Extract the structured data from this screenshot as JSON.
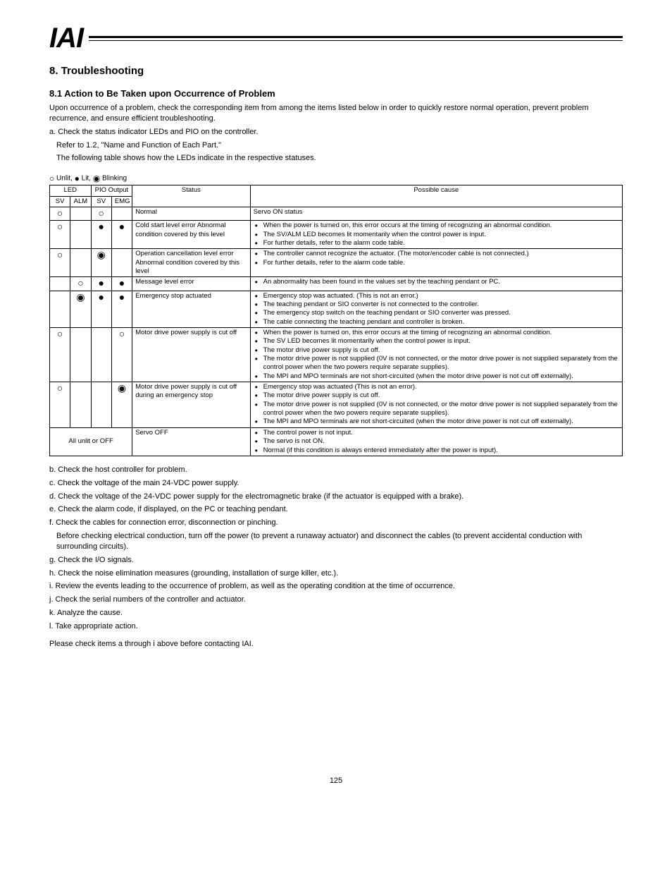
{
  "logo_text": "IAI",
  "section": {
    "number": "8.",
    "title": "Troubleshooting",
    "sub_number": "8.1",
    "sub_title": "Action to Be Taken upon Occurrence of Problem"
  },
  "intro1": "Upon occurrence of a problem, check the corresponding item from among the items listed below in order to quickly restore normal operation, prevent problem recurrence, and ensure efficient troubleshooting.",
  "check_a": {
    "label": "a. Check the status indicator LEDs and PIO on the controller.",
    "ref": "Refer to 1.2, \"Name and Function of Each Part.\""
  },
  "led_table_intro": "The following table shows how the LEDs indicate in the respective statuses.",
  "legend": {
    "unlit": "Unlit,",
    "lit": "Lit,",
    "blink": "Blinking"
  },
  "headers": {
    "led": "LED",
    "pio": "PIO Output",
    "alm": "ALM",
    "sv": "SV",
    "emg": "EMG",
    "status": "Status",
    "cause": "Possible cause"
  },
  "rows": {
    "r1": {
      "status": "Normal",
      "cause_note": "Servo ON status"
    },
    "r2": {
      "status": "Cold start level error Abnormal condition covered by this level",
      "c1": "When the power is turned on, this error occurs at the timing of recognizing an abnormal condition.",
      "c2": "The SV/ALM LED becomes lit momentarily when the control power is input.",
      "c3": "For further details, refer to the alarm code table."
    },
    "r3": {
      "status": "Operation cancellation level error Abnormal condition covered by this level",
      "c1": "The controller cannot recognize the actuator. (The motor/encoder cable is not connected.)",
      "c2": "For further details, refer to the alarm code table."
    },
    "r4": {
      "status": "Message level error",
      "c1": "An abnormality has been found in the values set by the teaching pendant or PC."
    },
    "r5": {
      "status": "Emergency stop actuated",
      "c1": "Emergency stop was actuated. (This is not an error.)",
      "c2": "The teaching pendant or SIO converter is not connected to the controller.",
      "c3": "The emergency stop switch on the teaching pendant or SIO converter was pressed.",
      "c4": "The cable connecting the teaching pendant and controller is broken."
    },
    "r6": {
      "status": "Motor drive power supply is cut off",
      "c1": "When the power is turned on, this error occurs at the timing of recognizing an abnormal condition.",
      "c2": "The SV LED becomes lit momentarily when the control power is input.",
      "c3": "The motor drive power supply is cut off.",
      "c4": "The motor drive power is not supplied (0V is not connected, or the motor drive power is not supplied separately from the control power when the two powers require separate supplies).",
      "c5": "The MPI and MPO terminals are not short-circuited (when the motor drive power is not cut off externally)."
    },
    "r7": {
      "status": "Motor drive power supply is cut off during an emergency stop",
      "c1": "Emergency stop was actuated (This is not an error).",
      "c2": "The motor drive power supply is cut off.",
      "c3": "The motor drive power is not supplied (0V is not connected, or the motor drive power is not supplied separately from the control power when the two powers require separate supplies).",
      "c4": "The MPI and MPO terminals are not short-circuited (when the motor drive power is not cut off externally)."
    },
    "r8": {
      "status": "Servo OFF",
      "c1": "The control power is not input.",
      "c2": "The servo is not ON.",
      "c3": "Normal (if this condition is always entered immediately after the power is input)."
    }
  },
  "r8_note": "All unlit or OFF",
  "checks": {
    "b": {
      "label": "b. Check the host controller for problem."
    },
    "c": {
      "label": "c. Check the voltage of the main 24-VDC power supply."
    },
    "d": {
      "label": "d. Check the voltage of the 24-VDC power supply for the electromagnetic brake (if the actuator is equipped with a brake)."
    },
    "e": {
      "label": "e. Check the alarm code, if displayed, on the PC or teaching pendant."
    },
    "f": {
      "label": "f. Check the cables for connection error, disconnection or pinching.",
      "note": "Before checking electrical conduction, turn off the power (to prevent a runaway actuator) and disconnect the cables (to prevent accidental conduction with surrounding circuits)."
    },
    "g": {
      "label": "g. Check the I/O signals."
    },
    "h": {
      "label": "h. Check the noise elimination measures (grounding, installation of surge killer, etc.)."
    },
    "i": {
      "label": "i. Review the events leading to the occurrence of problem, as well as the operating condition at the time of occurrence."
    },
    "j": {
      "label": "j. Check the serial numbers of the controller and actuator."
    },
    "k": {
      "label": "k. Analyze the cause."
    },
    "l": {
      "label": "l. Take appropriate action."
    }
  },
  "closing": "Please check items a through i above before contacting IAI.",
  "page_number": "125"
}
